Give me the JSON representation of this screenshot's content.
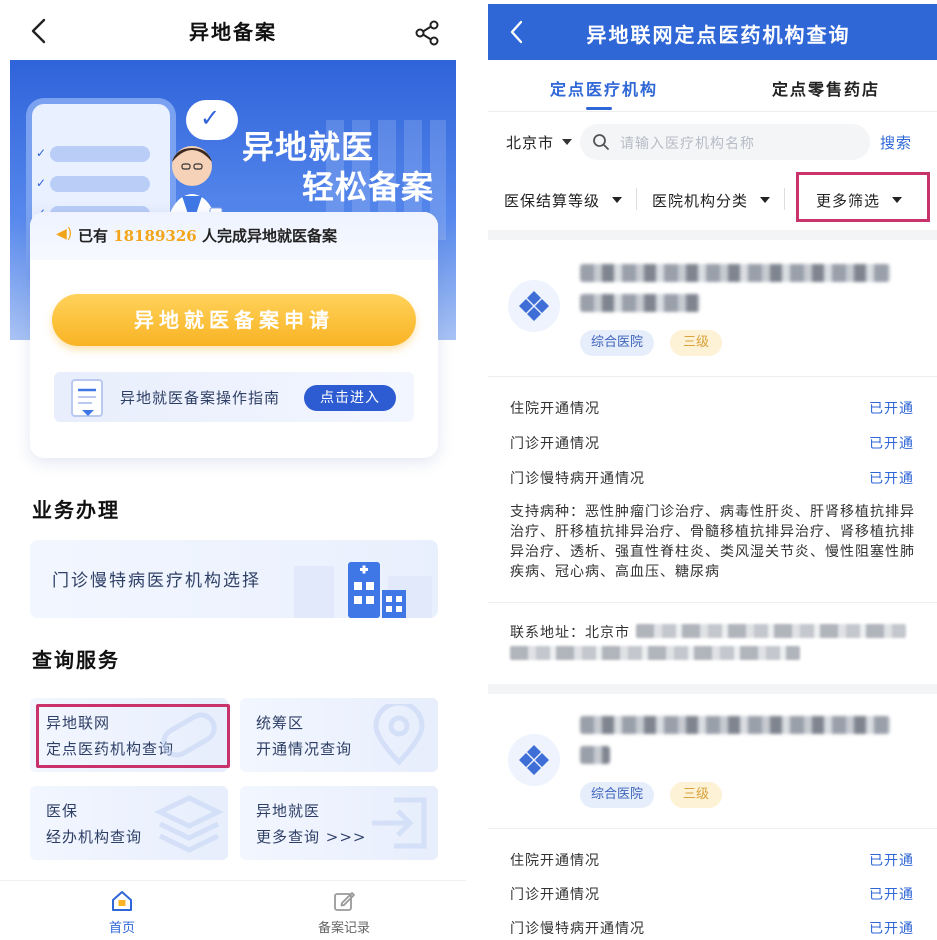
{
  "left": {
    "nav": {
      "title": "异地备案"
    },
    "banner": {
      "line1": "异地就医",
      "line2": "轻松备案"
    },
    "stat": {
      "prefix": "已有",
      "count": "18189326",
      "suffix": "人完成异地就医备案"
    },
    "apply_button": "异地就医备案申请",
    "guide": {
      "label": "异地就医备案操作指南",
      "button": "点击进入"
    },
    "business": {
      "section_title": "业务办理",
      "item": "门诊慢特病医疗机构选择"
    },
    "query": {
      "section_title": "查询服务",
      "tiles": [
        {
          "line1": "异地联网",
          "line2": "定点医药机构查询"
        },
        {
          "line1": "统筹区",
          "line2": "开通情况查询"
        },
        {
          "line1": "医保",
          "line2": "经办机构查询"
        },
        {
          "line1": "异地就医",
          "line2": "更多查询 >>>"
        }
      ]
    },
    "tabbar": [
      {
        "label": "首页",
        "active": true
      },
      {
        "label": "备案记录",
        "active": false
      }
    ]
  },
  "right": {
    "nav": {
      "title": "异地联网定点医药机构查询"
    },
    "tabs": [
      {
        "label": "定点医疗机构",
        "active": true
      },
      {
        "label": "定点零售药店",
        "active": false
      }
    ],
    "search": {
      "city": "北京市",
      "placeholder": "请输入医疗机构名称",
      "button": "搜索"
    },
    "filters": [
      "医保结算等级",
      "医院机构分类",
      "更多筛选"
    ],
    "institutions": [
      {
        "tags": [
          "综合医院",
          "三级"
        ],
        "rows": [
          {
            "label": "住院开通情况",
            "value": "已开通"
          },
          {
            "label": "门诊开通情况",
            "value": "已开通"
          },
          {
            "label": "门诊慢特病开通情况",
            "value": "已开通"
          }
        ],
        "diseases": "支持病种：恶性肿瘤门诊治疗、病毒性肝炎、肝肾移植抗排异治疗、肝移植抗排异治疗、骨髓移植抗排异治疗、肾移植抗排异治疗、透析、强直性脊柱炎、类风湿关节炎、慢性阻塞性肺疾病、冠心病、高血压、糖尿病",
        "address_label": "联系地址：北京市"
      },
      {
        "tags": [
          "综合医院",
          "三级"
        ],
        "rows": [
          {
            "label": "住院开通情况",
            "value": "已开通"
          },
          {
            "label": "门诊开通情况",
            "value": "已开通"
          },
          {
            "label": "门诊慢特病开通情况",
            "value": "已开通"
          }
        ]
      }
    ]
  },
  "colors": {
    "primary_blue": "#2f67d6",
    "accent_orange": "#f9b324",
    "highlight_border": "#c8336b"
  }
}
